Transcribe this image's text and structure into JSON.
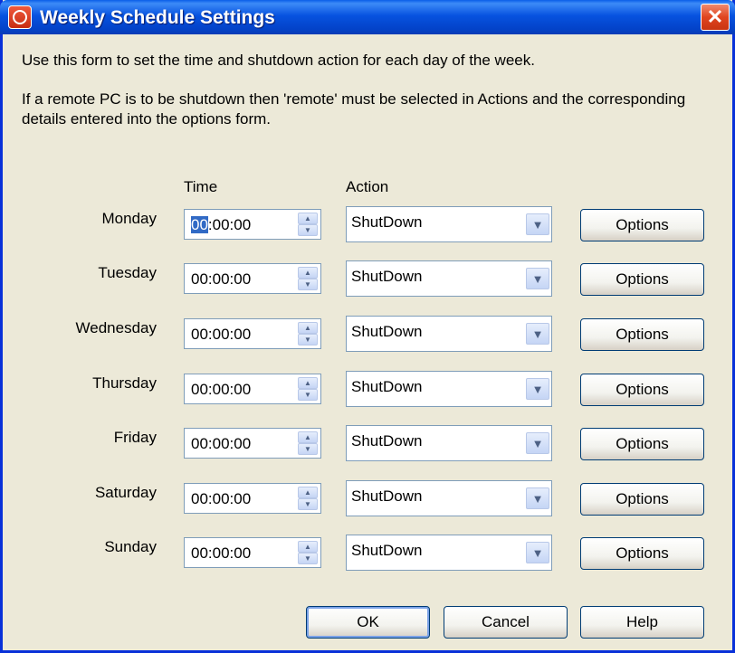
{
  "window": {
    "title": "Weekly Schedule Settings",
    "close_label": "✕"
  },
  "description": {
    "line1": "Use this form to set the time and shutdown action for each day of the week.",
    "line2": "If a remote PC is to be shutdown then 'remote' must be selected in Actions and the corresponding details entered into the options form."
  },
  "columns": {
    "time": "Time",
    "action": "Action"
  },
  "days": [
    {
      "label": "Monday",
      "time_sel": "00",
      "time_rest": ":00:00",
      "action": "ShutDown",
      "options_label": "Options"
    },
    {
      "label": "Tuesday",
      "time_sel": "",
      "time_rest": "00:00:00",
      "action": "ShutDown",
      "options_label": "Options"
    },
    {
      "label": "Wednesday",
      "time_sel": "",
      "time_rest": "00:00:00",
      "action": "ShutDown",
      "options_label": "Options"
    },
    {
      "label": "Thursday",
      "time_sel": "",
      "time_rest": "00:00:00",
      "action": "ShutDown",
      "options_label": "Options"
    },
    {
      "label": "Friday",
      "time_sel": "",
      "time_rest": "00:00:00",
      "action": "ShutDown",
      "options_label": "Options"
    },
    {
      "label": "Saturday",
      "time_sel": "",
      "time_rest": "00:00:00",
      "action": "ShutDown",
      "options_label": "Options"
    },
    {
      "label": "Sunday",
      "time_sel": "",
      "time_rest": "00:00:00",
      "action": "ShutDown",
      "options_label": "Options"
    }
  ],
  "footer": {
    "ok_label": "OK",
    "cancel_label": "Cancel",
    "help_label": "Help"
  },
  "colors": {
    "titlebar": "#0753e0",
    "dialog_bg": "#ece9d8",
    "close_button": "#e0451f",
    "selection": "#316ac5"
  },
  "icons": {
    "app": "power-icon",
    "close": "close-icon",
    "spin": "spin-arrows-icon",
    "dropdown": "chevron-down-icon"
  }
}
